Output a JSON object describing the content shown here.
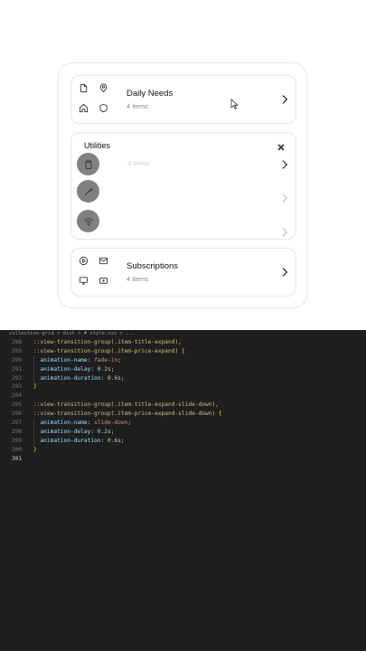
{
  "cards": {
    "daily": {
      "title": "Daily Needs",
      "count": "4 items",
      "icons": [
        "document-icon",
        "location-pin-icon",
        "home-icon",
        "shield-icon"
      ]
    },
    "utilities": {
      "title": "Utilities",
      "count": "3 items",
      "icons": [
        "clipboard-icon",
        "brush-icon",
        "wifi-icon"
      ]
    },
    "subscriptions": {
      "title": "Subscriptions",
      "count": "4 items",
      "icons": [
        "play-icon",
        "mail-icon",
        "monitor-icon",
        "ticket-icon"
      ]
    }
  },
  "editor": {
    "breadcrumb": "collection-grid > dist > # style.css > ...",
    "lines": [
      {
        "n": "288",
        "text": "::view-transition-group(.item-title-expand),",
        "kind": "sel"
      },
      {
        "n": "289",
        "text": "::view-transition-group(.item-price-expand) {",
        "kind": "sel"
      },
      {
        "n": "290",
        "prop": "animation-name",
        "value": "fade-in",
        "kind": "decl"
      },
      {
        "n": "291",
        "prop": "animation-delay",
        "value": "0.2s",
        "kind": "decl"
      },
      {
        "n": "292",
        "prop": "animation-duration",
        "value": "0.6s",
        "kind": "decl"
      },
      {
        "n": "293",
        "text": "}",
        "kind": "close"
      },
      {
        "n": "294",
        "text": "",
        "kind": "blank"
      },
      {
        "n": "295",
        "text": "::view-transition-group(.item-title-expand-slide-down),",
        "kind": "sel"
      },
      {
        "n": "296",
        "text": "::view-transition-group(.item-price-expand-slide-down) {",
        "kind": "sel"
      },
      {
        "n": "297",
        "prop": "animation-name",
        "value": "slide-down",
        "kind": "decl"
      },
      {
        "n": "298",
        "prop": "animation-delay",
        "value": "0.2s",
        "kind": "decl"
      },
      {
        "n": "299",
        "prop": "animation-duration",
        "value": "0.6s",
        "kind": "decl"
      },
      {
        "n": "300",
        "text": "}",
        "kind": "close"
      },
      {
        "n": "301",
        "text": "",
        "kind": "blank",
        "active": true
      }
    ]
  },
  "colors": {
    "circle": "#808080",
    "editor_bg": "#1e1e1e",
    "selector": "#d7ba7d",
    "property": "#9cdcfe",
    "value": "#ce9178"
  }
}
